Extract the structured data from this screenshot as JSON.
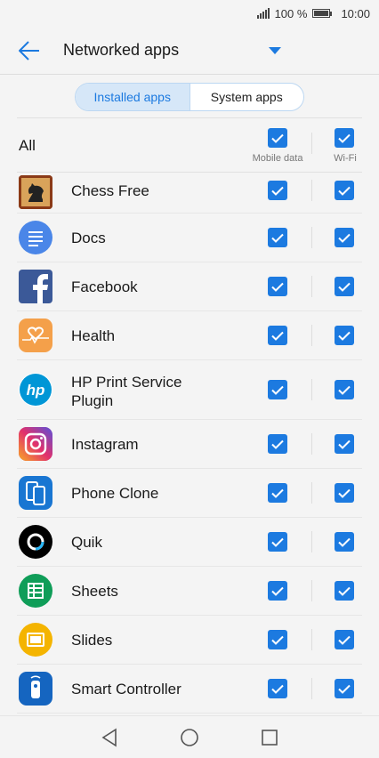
{
  "status": {
    "battery_percent": "100 %",
    "time": "10:00"
  },
  "header": {
    "title": "Networked apps"
  },
  "tabs": [
    {
      "label": "Installed apps",
      "active": true
    },
    {
      "label": "System apps",
      "active": false
    }
  ],
  "all_row": {
    "label": "All",
    "mobile_data_label": "Mobile data",
    "wifi_label": "Wi-Fi",
    "mobile_checked": true,
    "wifi_checked": true
  },
  "apps": [
    {
      "name": "Chess Free",
      "icon": "chess-icon",
      "mobile": true,
      "wifi": true
    },
    {
      "name": "Docs",
      "icon": "docs-icon",
      "mobile": true,
      "wifi": true
    },
    {
      "name": "Facebook",
      "icon": "facebook-icon",
      "mobile": true,
      "wifi": true
    },
    {
      "name": "Health",
      "icon": "health-icon",
      "mobile": true,
      "wifi": true
    },
    {
      "name": "HP Print Service Plugin",
      "icon": "hp-icon",
      "mobile": true,
      "wifi": true
    },
    {
      "name": "Instagram",
      "icon": "instagram-icon",
      "mobile": true,
      "wifi": true
    },
    {
      "name": "Phone Clone",
      "icon": "phone-clone-icon",
      "mobile": true,
      "wifi": true
    },
    {
      "name": "Quik",
      "icon": "quik-icon",
      "mobile": true,
      "wifi": true
    },
    {
      "name": "Sheets",
      "icon": "sheets-icon",
      "mobile": true,
      "wifi": true
    },
    {
      "name": "Slides",
      "icon": "slides-icon",
      "mobile": true,
      "wifi": true
    },
    {
      "name": "Smart Controller",
      "icon": "smart-controller-icon",
      "mobile": true,
      "wifi": true
    }
  ],
  "colors": {
    "accent": "#1c7ae0",
    "background": "#f4f4f4"
  }
}
